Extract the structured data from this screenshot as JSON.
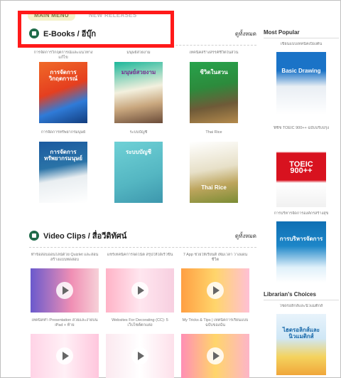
{
  "tabs": [
    {
      "label": "MAIN MENU",
      "active": true
    },
    {
      "label": "NEW RELEASES",
      "active": false
    }
  ],
  "ebooks": {
    "title": "E-Books / อีบุ๊ก",
    "view_all": "ดูทั้งหมด",
    "items": [
      {
        "caption": "การจัดการวิกฤตการณ์และแนวทางแก้ไข",
        "cover_text": "การจัดการวิกฤตการณ์"
      },
      {
        "caption": "มนุษย์สวยงาม",
        "cover_text": "มนุษย์สวยงาม"
      },
      {
        "caption": "เทคนิคสร้างสรรค์ชีวิตในสวน",
        "cover_text": "ชีวิตในสวน"
      },
      {
        "caption": "การจัดการทรัพยากรมนุษย์",
        "cover_text": "การจัดการทรัพยากรมนุษย์"
      },
      {
        "caption": "ระบบบัญชี",
        "cover_text": "ระบบบัญชี"
      },
      {
        "caption": "Thai Rice",
        "cover_text": "Thai Rice"
      }
    ]
  },
  "videos": {
    "title": "Video Clips / สื่อวีดิทัศน์",
    "view_all": "ดูทั้งหมด",
    "items": [
      {
        "caption": "ทำข้อสอบออนไลน์ด้วย Quizlet และสอนสร้างแบบทดสอบ"
      },
      {
        "caption": "แชร์เทคนิคการจดโน้ต สรุปให้ได้เร็วขึ้น"
      },
      {
        "caption": "7 App ช่วยให้เรียนดี เพิ่มเวลา วางแผนชีวิต"
      },
      {
        "caption": "เทคนิคทำ Presentation สวยและง่ายบน iPad + ท้าย"
      },
      {
        "caption": "Websites For Decorating (CC): 5 เว็บไซต์ตกแต่ง"
      },
      {
        "caption": "My Tricks & Tips | เทคนิคการเรียนแบบฉบับของฉัน"
      }
    ]
  },
  "sidebar": {
    "popular_title": "Most Popular",
    "choices_title": "Librarian's Choices",
    "popular": [
      {
        "caption": "เขียนแบบเทคนิคเบื้องต้น",
        "cover_text": "Basic Drawing"
      },
      {
        "caption": "ฟิชิช TOEIC 900++ ฉบับปรับปรุง",
        "cover_text": "TOEIC 900++"
      },
      {
        "caption": "การบริหารจัดการองค์กรสร้างสุข",
        "cover_text": "การบริหารจัดการ"
      }
    ],
    "choices": [
      {
        "caption": "ไซดรอลิกส์และนิวแมติกส์",
        "cover_text": "ไฮดรอลิกส์และนิวแมติกส์"
      }
    ]
  }
}
